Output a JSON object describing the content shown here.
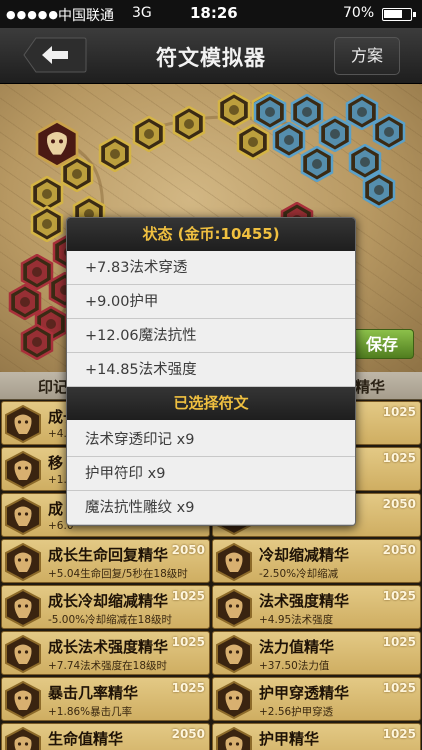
{
  "status_bar": {
    "signal_dots": "●●●●●",
    "carrier": "中国联通",
    "network": "3G",
    "time": "18:26",
    "battery_pct": "70%",
    "battery_level": 0.7
  },
  "navbar": {
    "back_icon": "back-arrow-icon",
    "title": "符文模拟器",
    "plan_label": "方案"
  },
  "board": {
    "save_label": "保存",
    "colors": {
      "yellow": "#d4b444",
      "blue": "#5aa0c8",
      "red": "#a8303a",
      "gold": "#caa24a"
    }
  },
  "list_header": {
    "left": "印记",
    "right": "精华"
  },
  "popup": {
    "status_title": "状态 (金币:10455)",
    "stats": [
      "+7.83法术穿透",
      "+9.00护甲",
      "+12.06魔法抗性",
      "+14.85法术强度"
    ],
    "selected_title": "已选择符文",
    "selected": [
      "法术穿透印记 x9",
      "护甲符印 x9",
      "魔法抗性雕纹 x9"
    ]
  },
  "runes": [
    {
      "name": "成长",
      "desc": "+4.8",
      "price": ""
    },
    {
      "name": "",
      "desc": "",
      "price": "1025"
    },
    {
      "name": "移",
      "desc": "+1.5",
      "price": ""
    },
    {
      "name": "",
      "desc": "",
      "price": "1025"
    },
    {
      "name": "成",
      "desc": "+6.0",
      "price": ""
    },
    {
      "name": "",
      "desc": "",
      "price": "2050"
    },
    {
      "name": "成长生命回复精华",
      "desc": "+5.04生命回复/5秒在18级时",
      "price": "2050"
    },
    {
      "name": "冷却缩减精华",
      "desc": "-2.50%冷却缩减",
      "price": "2050"
    },
    {
      "name": "成长冷却缩减精华",
      "desc": "-5.00%冷却缩减在18级时",
      "price": "1025"
    },
    {
      "name": "法术强度精华",
      "desc": "+4.95法术强度",
      "price": "1025"
    },
    {
      "name": "成长法术强度精华",
      "desc": "+7.74法术强度在18级时",
      "price": "1025"
    },
    {
      "name": "法力值精华",
      "desc": "+37.50法力值",
      "price": "1025"
    },
    {
      "name": "暴击几率精华",
      "desc": "+1.86%暴击几率",
      "price": "1025"
    },
    {
      "name": "护甲穿透精华",
      "desc": "+2.56护甲穿透",
      "price": "1025"
    },
    {
      "name": "生命值精华",
      "desc": "",
      "price": "2050"
    },
    {
      "name": "护甲精华",
      "desc": "",
      "price": "1025"
    }
  ]
}
